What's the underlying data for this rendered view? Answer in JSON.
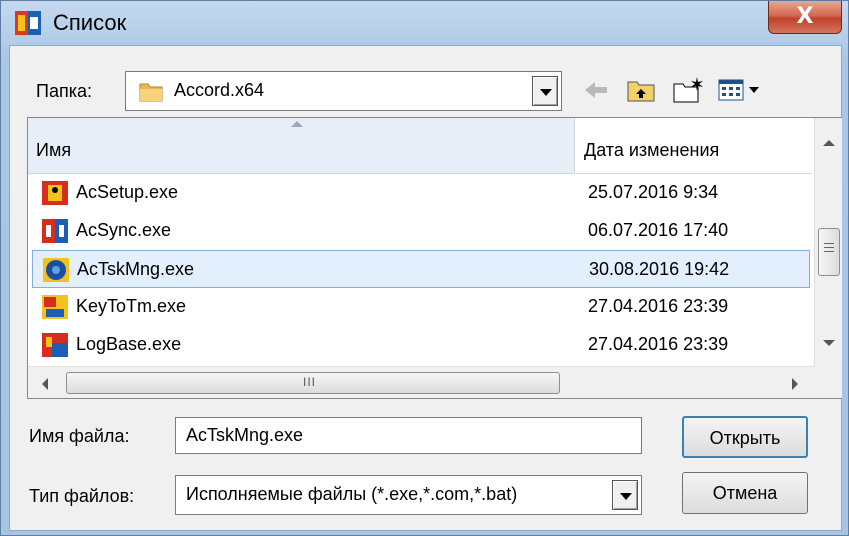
{
  "window": {
    "title": "Список",
    "close_glyph": "X"
  },
  "folder": {
    "label": "Папка:",
    "value": "Accord.x64",
    "icon": "folder-icon"
  },
  "toolbar": {
    "icons": [
      "back-arrow-icon",
      "up-folder-icon",
      "new-folder-icon",
      "view-menu-icon"
    ]
  },
  "list": {
    "columns": {
      "name": "Имя",
      "date": "Дата изменения"
    },
    "rows": [
      {
        "name": "AcSetup.exe",
        "date": "25.07.2016 9:34",
        "icon": "acsetup-app-icon"
      },
      {
        "name": "AcSync.exe",
        "date": "06.07.2016 17:40",
        "icon": "acsync-app-icon"
      },
      {
        "name": "AcTskMng.exe",
        "date": "30.08.2016 19:42",
        "icon": "actskmng-app-icon",
        "selected": true
      },
      {
        "name": "KeyToTm.exe",
        "date": "27.04.2016 23:39",
        "icon": "keytotm-app-icon"
      },
      {
        "name": "LogBase.exe",
        "date": "27.04.2016 23:39",
        "icon": "logbase-app-icon"
      }
    ],
    "hscroll_grip": "III"
  },
  "filename": {
    "label": "Имя файла:",
    "value": "AcTskMng.exe"
  },
  "filetype": {
    "label": "Тип файлов:",
    "value": "Исполняемые файлы (*.exe,*.com,*.bat)"
  },
  "buttons": {
    "open": "Открыть",
    "cancel": "Отмена"
  },
  "colors": {
    "selection": "#e3effc",
    "selection_border": "#84acdd",
    "close": "#c0412a"
  }
}
